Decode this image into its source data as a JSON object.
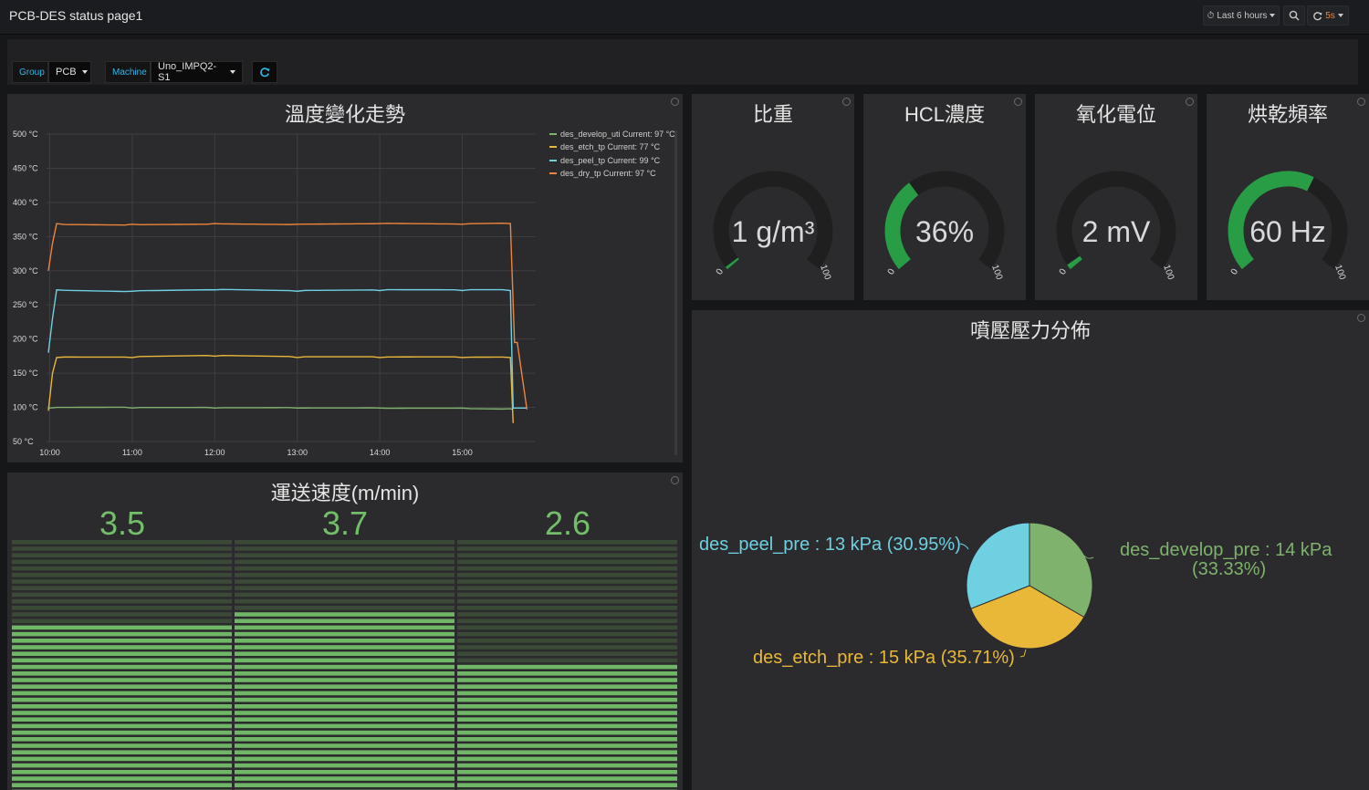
{
  "navbar": {
    "title": "PCB-DES status page1",
    "time_range": "Last 6 hours",
    "refresh_interval": "5s"
  },
  "variables": {
    "group_label": "Group",
    "group_value": "PCB",
    "machine_label": "Machine",
    "machine_value": "Uno_IMPQ2-S1"
  },
  "temp_panel": {
    "title": "溫度變化走勢",
    "chart_data": {
      "type": "line",
      "ylabel_unit": "°C",
      "y_ticks": [
        "500 °C",
        "450 °C",
        "400 °C",
        "350 °C",
        "300 °C",
        "250 °C",
        "200 °C",
        "150 °C",
        "100 °C",
        "50 °C"
      ],
      "x_ticks": [
        "10:00",
        "11:00",
        "12:00",
        "13:00",
        "14:00",
        "15:00"
      ],
      "ylim": [
        50,
        500
      ],
      "grid": true,
      "legend_position": "top-right",
      "series": [
        {
          "name": "des_develop_uti",
          "legend": "des_develop_uti  Current: 97 °C",
          "color": "#7eb26d",
          "x": [
            "09:59",
            "10:00",
            "11:00",
            "12:00",
            "13:00",
            "14:00",
            "15:00",
            "15:35",
            "15:37"
          ],
          "y": [
            98,
            99,
            99,
            99,
            99,
            99,
            99,
            98,
            97
          ]
        },
        {
          "name": "des_etch_tp",
          "legend": "des_etch_tp  Current: 77 °C",
          "color": "#eab839",
          "x": [
            "09:59",
            "10:02",
            "10:05",
            "11:00",
            "12:00",
            "13:00",
            "14:00",
            "15:00",
            "15:35",
            "15:37"
          ],
          "y": [
            95,
            150,
            173,
            173,
            175,
            173,
            173,
            173,
            173,
            77
          ]
        },
        {
          "name": "des_peel_tp",
          "legend": "des_peel_tp  Current: 99 °C",
          "color": "#6ed0e0",
          "x": [
            "09:59",
            "10:02",
            "10:05",
            "11:00",
            "12:00",
            "13:00",
            "14:00",
            "15:00",
            "15:35",
            "15:37",
            "15:47"
          ],
          "y": [
            180,
            230,
            272,
            270,
            272,
            270,
            271,
            271,
            271,
            99,
            99
          ]
        },
        {
          "name": "des_dry_tp",
          "legend": "des_dry_tp  Current: 97 °C",
          "color": "#ef843c",
          "x": [
            "09:59",
            "10:02",
            "10:05",
            "11:00",
            "12:00",
            "13:00",
            "14:00",
            "15:00",
            "15:35",
            "15:38",
            "15:40",
            "15:47"
          ],
          "y": [
            300,
            340,
            369,
            368,
            369,
            368,
            369,
            368,
            369,
            195,
            195,
            97
          ]
        }
      ]
    }
  },
  "gauges": [
    {
      "title": "比重",
      "value_text": "1 g/m³",
      "value": 1,
      "min_label": "0",
      "max_label": "100"
    },
    {
      "title": "HCL濃度",
      "value_text": "36%",
      "value": 36,
      "min_label": "0",
      "max_label": "100"
    },
    {
      "title": "氧化電位",
      "value_text": "2 mV",
      "value": 2,
      "min_label": "0",
      "max_label": "100"
    },
    {
      "title": "烘乾頻率",
      "value_text": "60 Hz",
      "value": 60,
      "min_label": "0",
      "max_label": "100"
    }
  ],
  "speed_panel": {
    "title": "運送速度(m/min)",
    "chart_data": {
      "type": "bar",
      "values": [
        3.5,
        3.7,
        2.6
      ],
      "labels": [
        "3.5",
        "3.7",
        "2.6"
      ],
      "ylim": [
        0,
        5.2
      ]
    }
  },
  "pressure_panel": {
    "title": "噴壓壓力分佈",
    "chart_data": {
      "type": "pie",
      "slices": [
        {
          "name": "des_develop_pre",
          "value": 14,
          "unit": "kPa",
          "percent": 33.33,
          "color": "#7eb26d",
          "label_line1": "des_develop_pre : 14 kPa",
          "label_line2": "(33.33%)"
        },
        {
          "name": "des_etch_pre",
          "value": 15,
          "unit": "kPa",
          "percent": 35.71,
          "color": "#eab839",
          "label_line1": "des_etch_pre : 15 kPa (35.71%)"
        },
        {
          "name": "des_peel_pre",
          "value": 13,
          "unit": "kPa",
          "percent": 30.95,
          "color": "#6ed0e0",
          "label_line1": "des_peel_pre : 13 kPa (30.95%)"
        }
      ]
    }
  },
  "colors": {
    "panel_bg": "#2b2b2d",
    "gauge_green": "#299c46",
    "stat_green": "#73bf69",
    "accent_orange": "#ef843c"
  }
}
